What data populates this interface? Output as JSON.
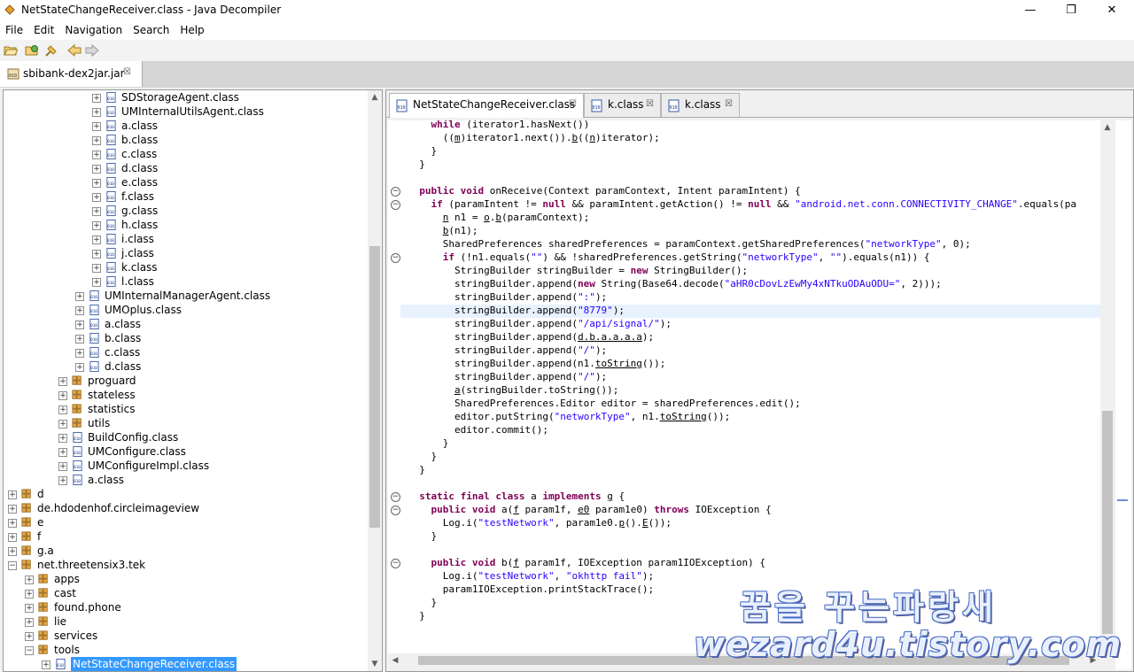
{
  "window": {
    "title": "NetStateChangeReceiver.class - Java Decompiler",
    "minimize": "—",
    "maximize": "❐",
    "close": "✕"
  },
  "menu": [
    "File",
    "Edit",
    "Navigation",
    "Search",
    "Help"
  ],
  "file_tab": {
    "label": "sbibank-dex2jar.jar",
    "close": "☒"
  },
  "tree": {
    "items": [
      {
        "label": "SDStorageAgent.class",
        "type": "class"
      },
      {
        "label": "UMInternalUtilsAgent.class",
        "type": "class"
      },
      {
        "label": "a.class",
        "type": "class"
      },
      {
        "label": "b.class",
        "type": "class"
      },
      {
        "label": "c.class",
        "type": "class"
      },
      {
        "label": "d.class",
        "type": "class"
      },
      {
        "label": "e.class",
        "type": "class"
      },
      {
        "label": "f.class",
        "type": "class"
      },
      {
        "label": "g.class",
        "type": "class"
      },
      {
        "label": "h.class",
        "type": "class"
      },
      {
        "label": "i.class",
        "type": "class"
      },
      {
        "label": "j.class",
        "type": "class"
      },
      {
        "label": "k.class",
        "type": "class"
      },
      {
        "label": "l.class",
        "type": "class"
      },
      {
        "label": "UMInternalManagerAgent.class",
        "type": "class"
      },
      {
        "label": "UMOplus.class",
        "type": "class"
      },
      {
        "label": "a.class",
        "type": "class"
      },
      {
        "label": "b.class",
        "type": "class"
      },
      {
        "label": "c.class",
        "type": "class"
      },
      {
        "label": "d.class",
        "type": "class"
      },
      {
        "label": "proguard",
        "type": "package"
      },
      {
        "label": "stateless",
        "type": "package"
      },
      {
        "label": "statistics",
        "type": "package"
      },
      {
        "label": "utils",
        "type": "package"
      },
      {
        "label": "BuildConfig.class",
        "type": "class"
      },
      {
        "label": "UMConfigure.class",
        "type": "class"
      },
      {
        "label": "UMConfigureImpl.class",
        "type": "class"
      },
      {
        "label": "a.class",
        "type": "class"
      },
      {
        "label": "d",
        "type": "package"
      },
      {
        "label": "de.hdodenhof.circleimageview",
        "type": "package"
      },
      {
        "label": "e",
        "type": "package"
      },
      {
        "label": "f",
        "type": "package"
      },
      {
        "label": "g.a",
        "type": "package"
      },
      {
        "label": "net.threetensix3.tek",
        "type": "package",
        "expanded": true
      },
      {
        "label": "apps",
        "type": "package"
      },
      {
        "label": "cast",
        "type": "package"
      },
      {
        "label": "found.phone",
        "type": "package"
      },
      {
        "label": "lie",
        "type": "package"
      },
      {
        "label": "services",
        "type": "package"
      },
      {
        "label": "tools",
        "type": "package",
        "expanded": true
      },
      {
        "label": "NetStateChangeReceiver.class",
        "type": "class",
        "selected": true
      }
    ]
  },
  "editor_tabs": [
    {
      "label": "NetStateChangeReceiver.class",
      "active": true
    },
    {
      "label": "k.class",
      "active": false
    },
    {
      "label": "k.class",
      "active": false
    }
  ],
  "watermark": {
    "line1": "꿈을 꾸는파랑새",
    "line2": "wezard4u.tistory.com"
  },
  "colors": {
    "keyword": "#7f0055",
    "string": "#2a00ff",
    "selection": "#3399ff",
    "current_line": "#e8f2fe"
  }
}
